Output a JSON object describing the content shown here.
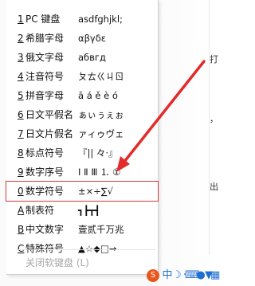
{
  "menu": {
    "items": [
      {
        "key": "1",
        "label": "PC 键盘",
        "sample": "asdfghjkl;"
      },
      {
        "key": "2",
        "label": "希腊字母",
        "sample": "αβγδε"
      },
      {
        "key": "3",
        "label": "俄文字母",
        "sample": "абвгд"
      },
      {
        "key": "4",
        "label": "注音符号",
        "sample": "ㄆㄊㄍㄐㄖ"
      },
      {
        "key": "5",
        "label": "拼音字母",
        "sample": "ā á ě è ó"
      },
      {
        "key": "6",
        "label": "日文平假名",
        "sample": "ぁぃぅぇぉ"
      },
      {
        "key": "7",
        "label": "日文片假名",
        "sample": "ァィゥヴェ"
      },
      {
        "key": "8",
        "label": "标点符号",
        "sample": "『|| 々·』"
      },
      {
        "key": "9",
        "label": "数字序号",
        "sample": "Ⅰ Ⅱ Ⅲ ⒈ ①"
      },
      {
        "key": "0",
        "label": "数学符号",
        "sample": "±×÷∑√"
      },
      {
        "key": "A",
        "label": "制表符",
        "sample": "┓┣┳┫"
      },
      {
        "key": "B",
        "label": "中文数字",
        "sample": "壹贰千万兆"
      },
      {
        "key": "C",
        "label": "特殊符号",
        "sample": "▲☆◆□→"
      }
    ],
    "close_label": "关闭软键盘 (L)"
  },
  "edge_chars": [
    "打",
    "，",
    "出"
  ],
  "colors": {
    "highlight_border": "#d63a3a",
    "arrow": "#e32b2b",
    "taskbar_accent": "#1f6fd1"
  },
  "taskbar": {
    "icons": [
      "sogou-s-icon",
      "zhong-input-icon",
      "moon-icon",
      "dot-icon",
      "keyboard-icon",
      "user-icon",
      "shirt-icon",
      "grid-icon"
    ],
    "zhong_label": "中"
  }
}
